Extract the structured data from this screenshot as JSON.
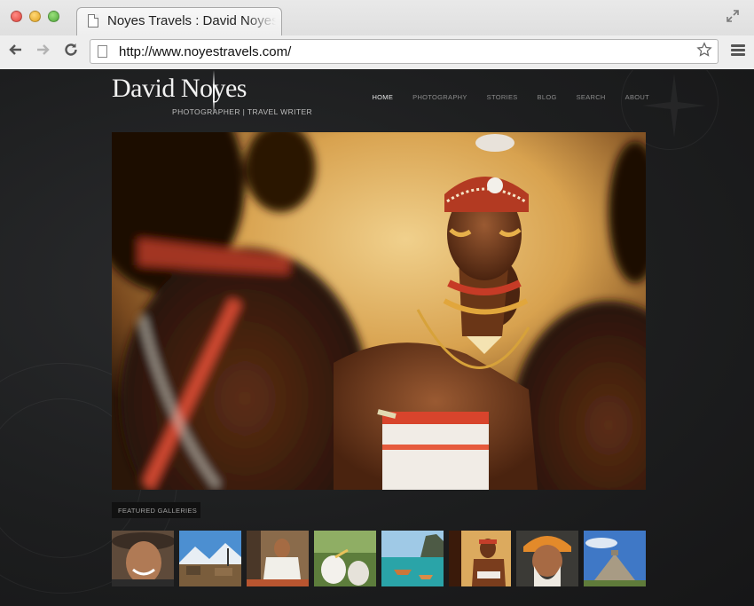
{
  "browser": {
    "tab_title": "Noyes Travels : David Noyes",
    "url": "http://www.noyestravels.com/",
    "icons": {
      "back": "arrow-left-icon",
      "forward": "arrow-right-icon",
      "reload": "reload-icon",
      "bookmark": "star-icon",
      "menu": "hamburger-menu-icon",
      "fullscreen": "expand-icon",
      "page": "page-icon"
    }
  },
  "site": {
    "logo_name": "David Noyes",
    "logo_tagline": "PHOTOGRAPHER | TRAVEL WRITER",
    "nav": [
      "HOME",
      "PHOTOGRAPHY",
      "STORIES",
      "BLOG",
      "SEARCH",
      "ABOUT"
    ],
    "nav_active": "HOME",
    "featured_label": "FEATURED GALLERIES",
    "thumbnails": [
      "smiling elderly woman in hat",
      "mountain village with blue sky",
      "man seated in white robes",
      "two white seabirds",
      "boats on turquoise water with cliffs",
      "beaded tribal warrior",
      "bearded man in orange turban",
      "Mayan pyramid under blue sky"
    ],
    "colors": {
      "background": "#1c1d1e",
      "nav_active": "#e4e4e4",
      "nav_inactive": "#8b8b8b"
    }
  }
}
